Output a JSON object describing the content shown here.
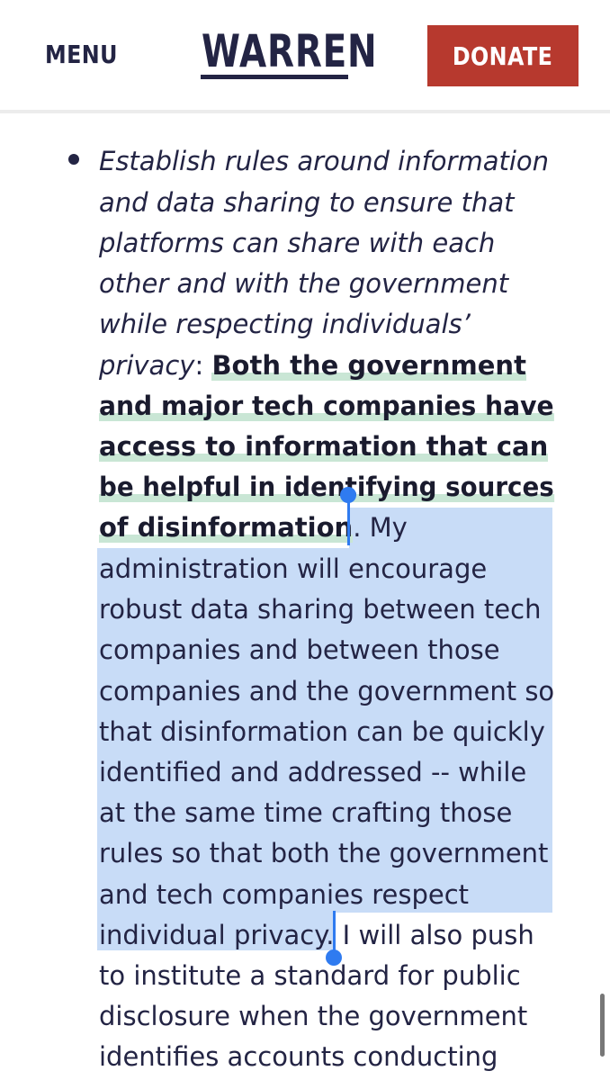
{
  "header": {
    "menu_label": "MENU",
    "logo_text": "WARREN",
    "donate_label": "DONATE"
  },
  "colors": {
    "brand_navy": "#232444",
    "donate_red": "#b7392e",
    "highlight_green": "#c9e6d5",
    "selection_blue": "#c8dcf7",
    "handle_blue": "#2f7bf0"
  },
  "article": {
    "l1": "Establish rules around information",
    "l2": "and data sharing to ensure that",
    "l3": "platforms can share with each",
    "l4": "other and with the government",
    "l5": "while respecting individuals’",
    "l6_italic": "privacy",
    "l6_colon": ": ",
    "l6_bold": "Both the government",
    "l7": "and major tech companies have",
    "l8": "access to information that can",
    "l9": "be helpful in identifying sources",
    "l10_bold": "of disinformation",
    "l10_period": ". ",
    "l10_sel": "My",
    "l11": "administration will encourage",
    "l12": "robust data sharing between tech",
    "l13": "companies and between those",
    "l14": "companies and the government so",
    "l15": "that disinformation can be quickly",
    "l16": "identified and addressed -- while",
    "l17": "at the same time crafting those",
    "l18": "rules so that both the government",
    "l19": "and tech companies respect",
    "l20_sel": "individual privacy.",
    "l20_rest": " I will also push",
    "l21": "to institute a standard for public",
    "l22": "disclosure when the government",
    "l23": "identifies accounts conducting"
  },
  "icons": {
    "bullet": "bullet-dot",
    "selection_start": "selection-handle-start",
    "selection_end": "selection-handle-end",
    "scrollbar": "scrollbar-thumb"
  }
}
